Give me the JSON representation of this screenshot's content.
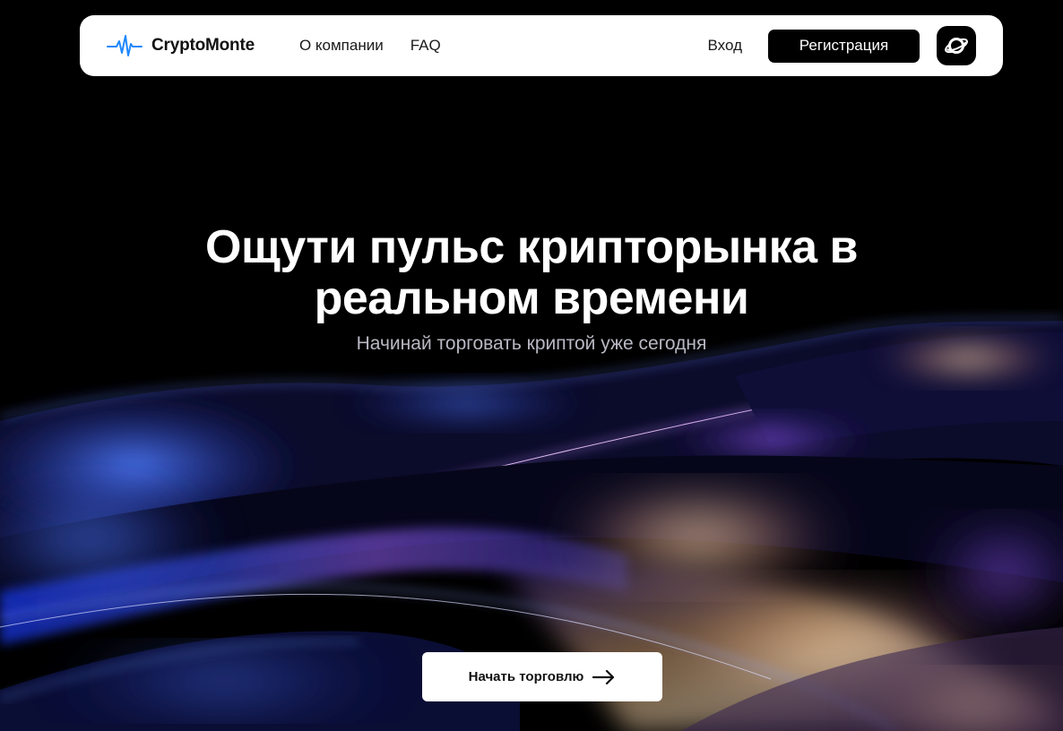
{
  "brand": {
    "name": "CryptoMonte",
    "logo_icon": "pulse-icon",
    "accent": "#1e88ff"
  },
  "nav": {
    "links": [
      "О компании",
      "FAQ"
    ],
    "login_label": "Вход",
    "register_label": "Регистрация",
    "planet_icon": "planet-icon"
  },
  "hero": {
    "title_line1": "Ощути пульс крипторынка в",
    "title_line2": "реальном времени",
    "subtitle": "Начинай торговать криптой уже сегодня",
    "cta_label": "Начать торговлю",
    "cta_icon": "arrow-right-icon"
  },
  "colors": {
    "background": "#000000",
    "navbar": "#ffffff",
    "button_dark": "#000000"
  }
}
